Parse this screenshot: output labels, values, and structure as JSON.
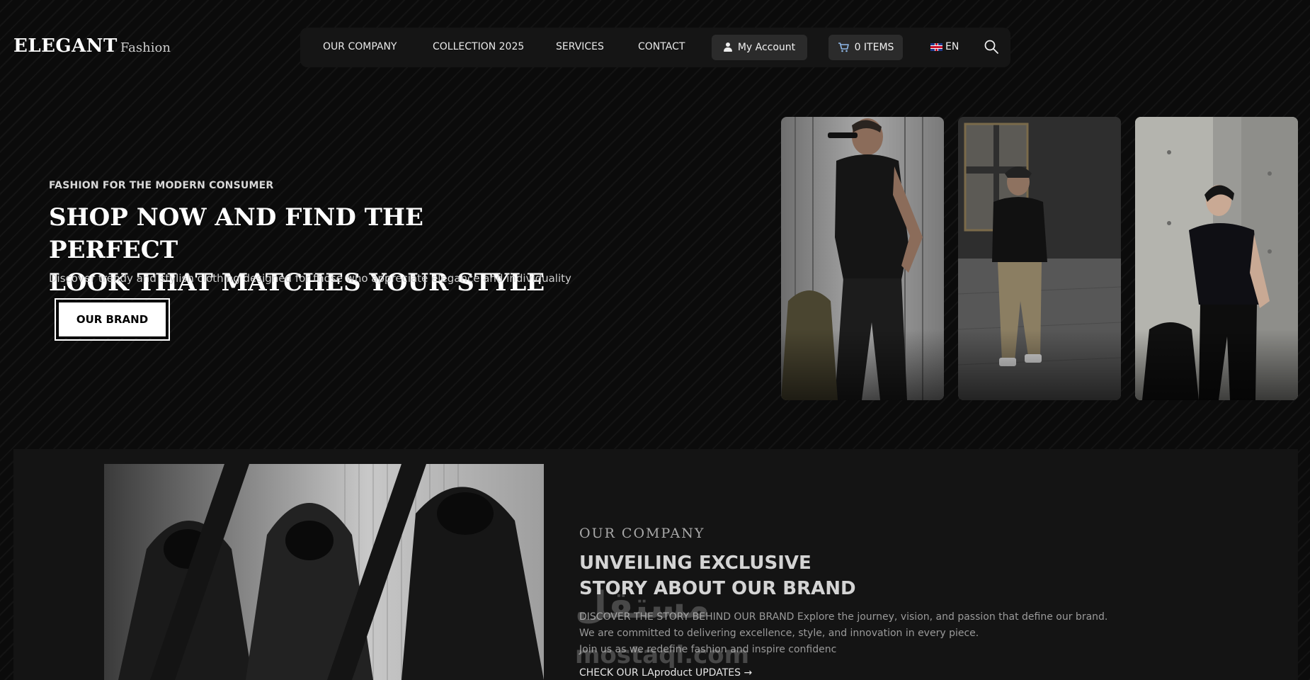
{
  "header": {
    "logo_main": "ELEGANT",
    "logo_sub": "Fashion",
    "nav": [
      "OUR COMPANY",
      "COLLECTION 2025",
      "SERVICES",
      "CONTACT"
    ],
    "account_label": "My Account",
    "cart_label": "0 ITEMS",
    "language": "EN",
    "icons": [
      "person-icon",
      "cart-icon",
      "uk-flag-icon",
      "search-icon"
    ]
  },
  "hero": {
    "kicker": "FASHION FOR THE MODERN CONSUMER",
    "title_line1": "SHOP NOW AND FIND THE PERFECT",
    "title_line2": "LOOK THAT MATCHES YOUR STYLE",
    "description": "Discover trendy and stylish clothing designed for those who appreciate elegance and individuality",
    "button_label": "OUR BRAND"
  },
  "company": {
    "kicker": "OUR COMPANY",
    "title_line1": "UNVEILING EXCLUSIVE",
    "title_line2": "STORY ABOUT OUR BRAND",
    "text_line1": "DISCOVER THE STORY BEHIND OUR BRAND Explore the journey, vision, and passion that define our brand.",
    "text_line2": "We are committed to delivering excellence, style, and innovation in every piece.",
    "text_line3": "Join us as we redefine fashion and inspire confidenc",
    "link_label": "CHECK OUR LAproduct UPDATES",
    "link_arrow": "→"
  },
  "watermark": {
    "arabic": "مستقل",
    "latin": "mostaql.com"
  },
  "colors": {
    "background": "#0b0b0b",
    "nav_bg": "#151515",
    "pill_bg": "#2b2b2b",
    "section_bg": "#141414",
    "accent": "#ffffff"
  }
}
